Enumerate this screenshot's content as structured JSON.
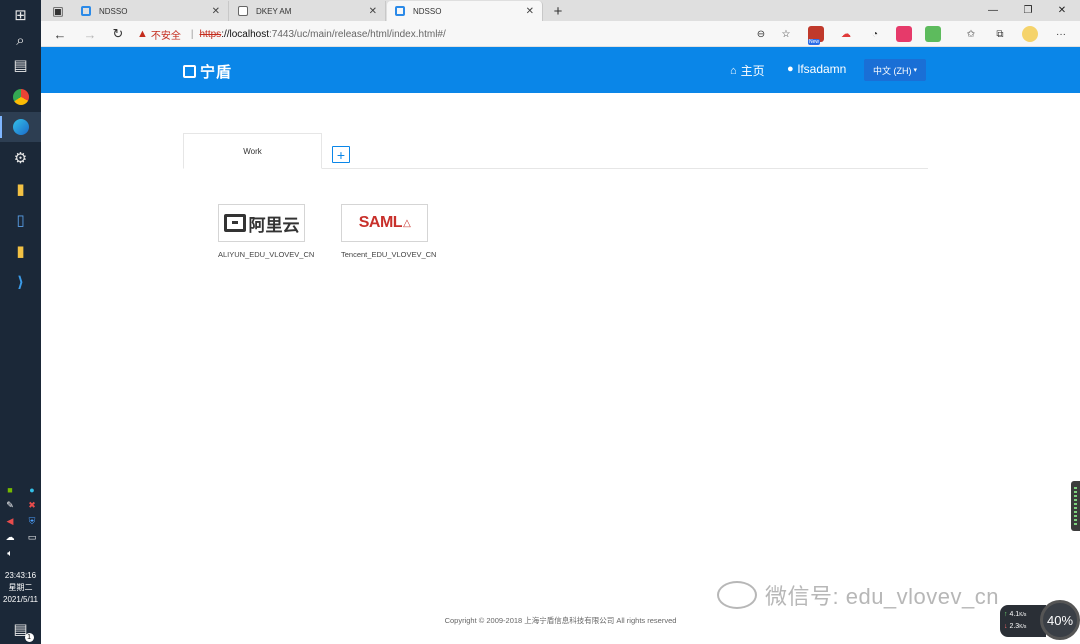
{
  "taskbar": {
    "clock_time": "23:43:16",
    "clock_day": "星期二",
    "clock_date": "2021/5/11",
    "notification_count": "1"
  },
  "browser": {
    "tabs": [
      {
        "label": "NDSSO",
        "active": false
      },
      {
        "label": "DKEY AM",
        "active": false
      },
      {
        "label": "NDSSO",
        "active": true
      }
    ],
    "new_tab_label": "+",
    "address": {
      "security_label": "不安全",
      "scheme": "https",
      "host": "://localhost",
      "path": ":7443/uc/main/release/html/index.html#/"
    },
    "new_badge": "New"
  },
  "header": {
    "logo_text": "宁盾",
    "home_label": "主页",
    "user_label": "lfsadamn",
    "language_label": "中文 (ZH)"
  },
  "panel": {
    "tab_label": "Work",
    "add_tab_label": "+",
    "apps": [
      {
        "name": "ALIYUN_EDU_VLOVEV_CN",
        "logo_text": "阿里云"
      },
      {
        "name": "Tencent_EDU_VLOVEV_CN",
        "logo_text": "SAML"
      }
    ]
  },
  "footer": {
    "copyright": "Copyright © 2009-2018 上海宁盾信息科技有限公司 All rights reserved"
  },
  "watermark": {
    "text": "微信号: edu_vlovev_cn"
  },
  "net_widget": {
    "upload": "4.1",
    "upload_unit": "K/s",
    "download": "2.3",
    "download_unit": "K/s",
    "percent": "40%"
  },
  "colors": {
    "header_bg": "#0a86e8",
    "accent": "#0a86e8",
    "insecure": "#c42b1c",
    "saml_red": "#c8302b"
  }
}
